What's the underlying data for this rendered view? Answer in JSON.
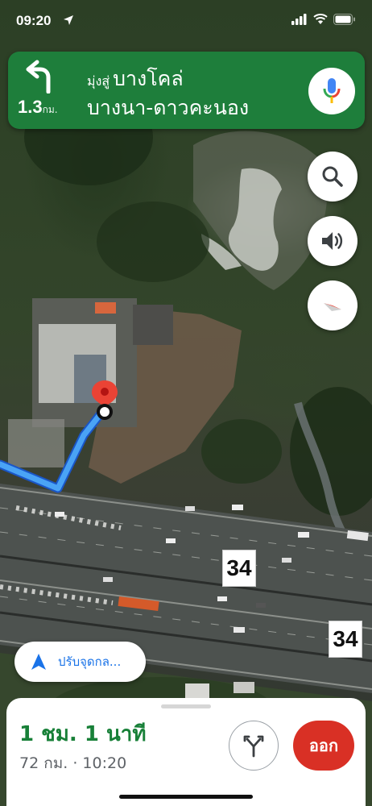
{
  "status_bar": {
    "time": "09:20"
  },
  "navigation": {
    "distance_value": "1.3",
    "distance_unit": "กม.",
    "direction_prefix": "มุ่งสู่",
    "destination_line1": "บางโคล่",
    "destination_line2": "บางนา-ดาวคะนอง"
  },
  "map": {
    "road_signs": [
      "34",
      "34"
    ]
  },
  "recenter": {
    "label": "ปรับจุดกล..."
  },
  "trip": {
    "duration": "1 ชม. 1 นาที",
    "details": "72 กม. · 10:20"
  },
  "buttons": {
    "exit_label": "ออก"
  },
  "colors": {
    "nav_green": "#1e7e3b",
    "route_blue": "#4285f4",
    "duration_green": "#188038",
    "exit_red": "#d93025",
    "pin_red": "#ea4335"
  },
  "icons": [
    "location-arrow-icon",
    "signal-icon",
    "wifi-icon",
    "battery-icon",
    "turn-left-icon",
    "microphone-icon",
    "search-icon",
    "speaker-icon",
    "compass-icon",
    "destination-pin-icon",
    "navigation-arrow-icon",
    "route-options-icon"
  ]
}
